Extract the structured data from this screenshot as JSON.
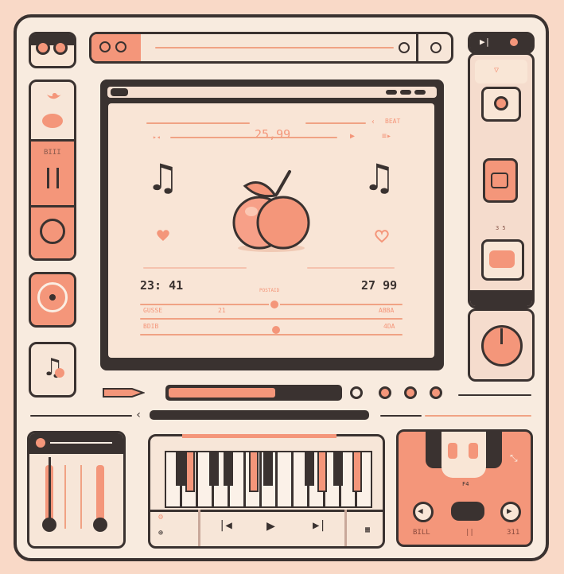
{
  "display": {
    "top_value": "25,99",
    "top_right_label": "BEAT",
    "left_time": "23: 41",
    "right_time": "27 99",
    "center_label": "POSTAID",
    "row1_left": "GUSSE",
    "row1_mid": "21",
    "row1_right": "ABBA",
    "row2_left": "BDIB",
    "row2_right": "4DA"
  },
  "left_panel": {
    "mid_label": "BIII"
  },
  "right_panel": {
    "mid_label": "3 5"
  },
  "pad_panel": {
    "left_label": "BILL",
    "mid_label": "F4",
    "right_label": "311"
  },
  "icons": {
    "music_note": "♫",
    "twitter": "bird-icon",
    "heart": "heart-icon"
  },
  "colors": {
    "accent": "#f4967a",
    "dark": "#3a3230",
    "background": "#f8ebdf",
    "screen": "#f9e5d6"
  }
}
